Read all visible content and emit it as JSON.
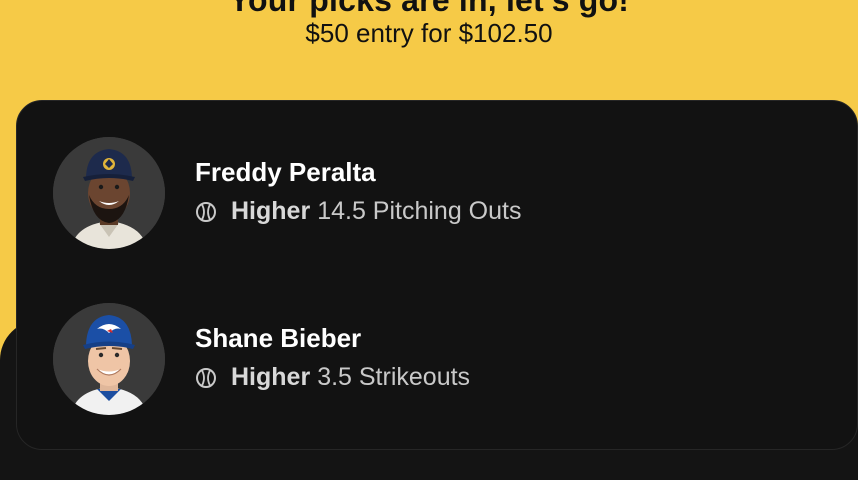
{
  "header": {
    "title": "Your picks are in, let's go!",
    "subtitle": "$50 entry for $102.50"
  },
  "colors": {
    "accent": "#f6ca47",
    "card_bg": "#121212",
    "text_primary": "#ffffff",
    "text_secondary": "#c9c9c9"
  },
  "picks": [
    {
      "player": "Freddy Peralta",
      "direction": "Higher",
      "line": "14.5 Pitching Outs",
      "icon": "baseball-icon"
    },
    {
      "player": "Shane Bieber",
      "direction": "Higher",
      "line": "3.5 Strikeouts",
      "icon": "baseball-icon"
    }
  ]
}
